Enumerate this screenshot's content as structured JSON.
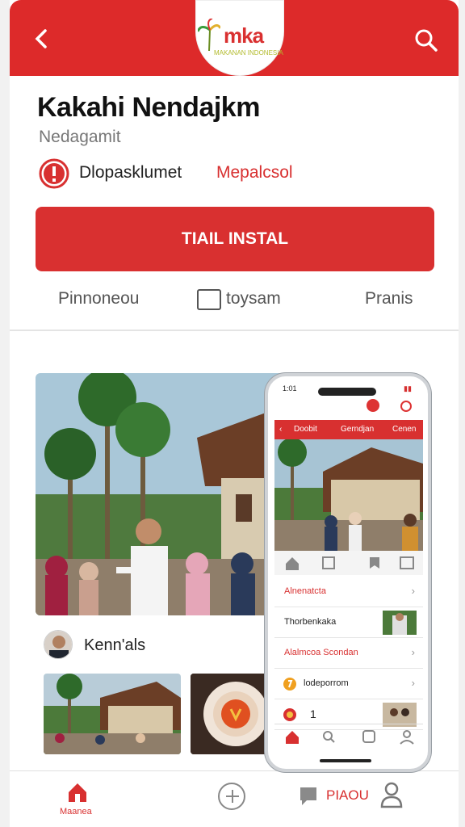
{
  "header": {
    "logo_text": "mka",
    "logo_sub": "MAKANAN INDONESIA"
  },
  "app": {
    "title": "Kakahi Nendajkm",
    "subtitle": "Nedagamit",
    "warning_text": "Dlopasklumet",
    "warning_accent": "Mepalcsol",
    "install_label": "TIAIL INSTAL",
    "meta": [
      "Pinnoneou",
      "toysam",
      "Pranis"
    ]
  },
  "post": {
    "author": "Kenn'als"
  },
  "phone": {
    "time": "1:01",
    "status": "▮▮",
    "header_tabs": [
      "Doobit",
      "Gerndjan",
      "Cenen"
    ],
    "list": [
      {
        "label": "Alnenatcta",
        "accent": true,
        "thumb": false
      },
      {
        "label": "Thorbenkaka",
        "accent": false,
        "thumb": true
      },
      {
        "label": "Alalmcoa Scondan",
        "accent": true,
        "thumb": false
      },
      {
        "label": "lodeporrom",
        "accent": false,
        "thumb": false
      },
      {
        "label": "1",
        "accent": false,
        "thumb": true
      }
    ]
  },
  "tabbar": {
    "home_label": "Maanea",
    "label": "PIAOU"
  },
  "colors": {
    "brand": "#dd2a2a",
    "accent": "#d83030"
  }
}
